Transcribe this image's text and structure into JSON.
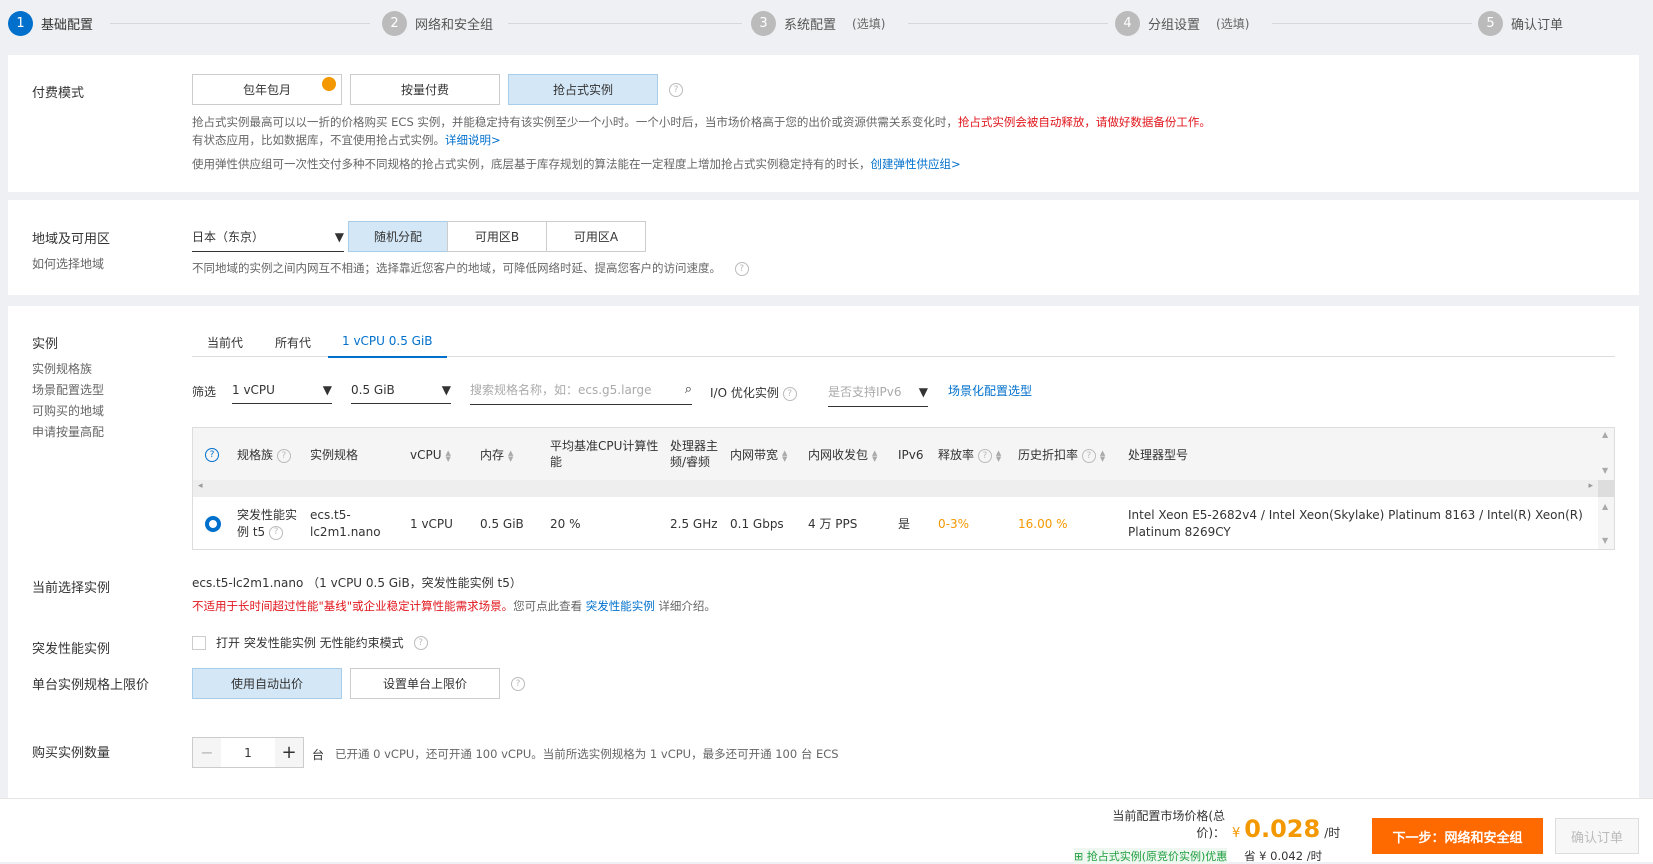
{
  "steps": [
    {
      "num": "1",
      "label": "基础配置",
      "opt": ""
    },
    {
      "num": "2",
      "label": "网络和安全组",
      "opt": ""
    },
    {
      "num": "3",
      "label": "系统配置",
      "opt": "(选填)"
    },
    {
      "num": "4",
      "label": "分组设置",
      "opt": "(选填)"
    },
    {
      "num": "5",
      "label": "确认订单",
      "opt": ""
    }
  ],
  "billing": {
    "label": "付费模式",
    "options": [
      "包年包月",
      "按量付费",
      "抢占式实例"
    ],
    "selected": "抢占式实例",
    "desc1": "抢占式实例最高可以以一折的价格购买 ECS 实例，并能稳定持有该实例至少一个小时。一个小时后，当市场价格高于您的出价或资源供需关系变化时，",
    "desc1_red": "抢占式实例会被自动释放，请做好数据备份工作。",
    "desc2": "有状态应用，比如数据库，不宜使用抢占式实例。",
    "desc2_link": "详细说明>",
    "desc3": "使用弹性供应组可一次性交付多种不同规格的抢占式实例，底层基于库存规划的算法能在一定程度上增加抢占式实例稳定持有的时长，",
    "desc3_link": "创建弹性供应组>"
  },
  "region": {
    "label": "地域及可用区",
    "help_link": "如何选择地域",
    "value": "日本（东京）",
    "zones": [
      "随机分配",
      "可用区B",
      "可用区A"
    ],
    "selected": "随机分配",
    "desc": "不同地域的实例之间内网互不相通；选择靠近您客户的地域，可降低网络时延、提高您客户的访问速度。"
  },
  "instance": {
    "label": "实例",
    "side_links": [
      "实例规格族",
      "场景配置选型",
      "可购买的地域",
      "申请按量高配"
    ],
    "tabs": [
      "当前代",
      "所有代",
      "1 vCPU 0.5 GiB"
    ],
    "active_tab": "1 vCPU 0.5 GiB",
    "filter": {
      "label": "筛选",
      "vcpu": "1 vCPU",
      "mem": "0.5 GiB",
      "search_placeholder": "搜索规格名称，如：ecs.g5.large",
      "io_label": "I/O 优化实例",
      "ipv6_placeholder": "是否支持IPv6",
      "scene_link": "场景化配置选型"
    },
    "columns": [
      "规格族",
      "实例规格",
      "vCPU",
      "内存",
      "平均基准CPU计算性能",
      "处理器主频/睿频",
      "内网带宽",
      "内网收发包",
      "IPv6",
      "释放率",
      "历史折扣率",
      "处理器型号"
    ],
    "rows": [
      {
        "family": "突发性能实例 t5",
        "spec": "ecs.t5-lc2m1.nano",
        "vcpu": "1 vCPU",
        "mem": "0.5 GiB",
        "baseline": "20 %",
        "freq": "2.5 GHz",
        "bw": "0.1 Gbps",
        "pps": "4 万 PPS",
        "ipv6": "是",
        "release": "0-3%",
        "discount": "16.00 %",
        "cpu": "Intel Xeon E5-2682v4 / Intel Xeon(Skylake) Platinum 8163 / Intel(R) Xeon(R) Platinum 8269CY"
      }
    ]
  },
  "current": {
    "label": "当前选择实例",
    "value": "ecs.t5-lc2m1.nano （1 vCPU 0.5 GiB，突发性能实例 t5）",
    "warn_red": "不适用于长时间超过性能\"基线\"或企业稳定计算性能需求场景。",
    "warn_text": "您可点此查看",
    "warn_link": "突发性能实例",
    "warn_tail": "详细介绍。"
  },
  "burst": {
    "label": "突发性能实例",
    "checkbox_label": "打开 突发性能实例 无性能约束模式",
    "checked": false
  },
  "price_limit": {
    "label": "单台实例规格上限价",
    "options": [
      "使用自动出价",
      "设置单台上限价"
    ],
    "selected": "使用自动出价"
  },
  "quantity": {
    "label": "购买实例数量",
    "value": "1",
    "unit": "台",
    "info": "已开通 0 vCPU，还可开通 100 vCPU。当前所选实例规格为 1 vCPU，最多还可开通 100 台 ECS"
  },
  "footer": {
    "price_label1": "当前配置市场价格(总",
    "price_label2": "价)：",
    "currency": "¥",
    "price": "0.028",
    "per": "/时",
    "promo": "抢占式实例(原竞价实例)优惠",
    "save": "省 ¥ 0.042 /时",
    "next": "下一步：网络和安全组",
    "confirm": "确认订单"
  },
  "colors": {
    "primary": "#0070cc",
    "orange": "#ff6a00",
    "red": "#e0161c",
    "price": "#f39800"
  }
}
